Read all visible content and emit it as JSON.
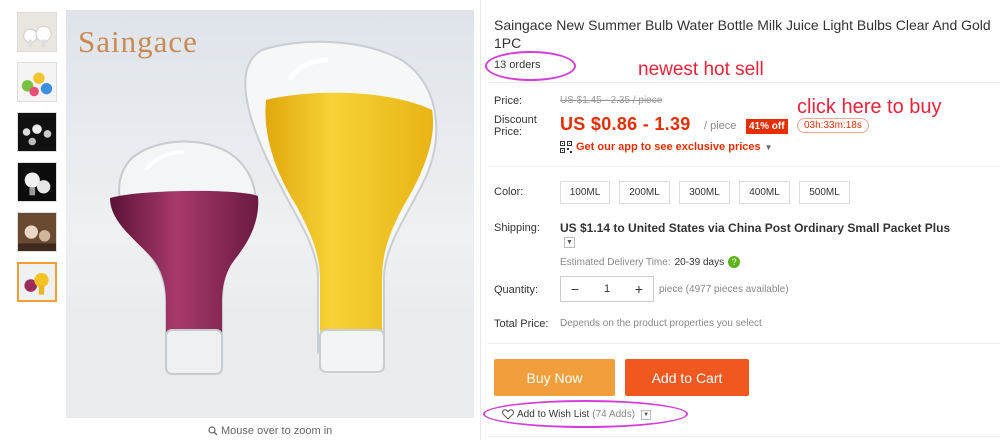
{
  "brand": "Saingace",
  "thumbnails": [
    "thumb-1",
    "thumb-2",
    "thumb-3",
    "thumb-4",
    "thumb-5",
    "thumb-6"
  ],
  "zoom_hint": "Mouse over to zoom in",
  "product": {
    "title": "Saingace New Summer Bulb Water Bottle Milk Juice Light Bulbs Clear And Gold 1PC",
    "orders": "13 orders"
  },
  "annotations": {
    "hot": "newest hot sell",
    "buy": "click here to buy"
  },
  "price": {
    "label": "Price:",
    "original": "US $1.45 - 2.35 / piece",
    "discount_label_1": "Discount",
    "discount_label_2": "Price:",
    "discount": "US $0.86 - 1.39",
    "unit": "/ piece",
    "off": "41% off",
    "timer": "03h:33m:18s",
    "app_promo": "Get our app to see exclusive prices"
  },
  "color": {
    "label": "Color:",
    "options": [
      "100ML",
      "200ML",
      "300ML",
      "400ML",
      "500ML"
    ]
  },
  "shipping": {
    "label": "Shipping:",
    "text": "US $1.14 to United States via China Post Ordinary Small Packet Plus",
    "delivery_label": "Estimated Delivery Time:",
    "delivery_days": "20-39 days"
  },
  "quantity": {
    "label": "Quantity:",
    "minus": "−",
    "value": "1",
    "plus": "+",
    "stock": "piece (4977 pieces available)"
  },
  "total": {
    "label": "Total Price:",
    "note": "Depends on the product properties you select"
  },
  "buttons": {
    "buy_now": "Buy Now",
    "add_to_cart": "Add to Cart"
  },
  "wishlist": {
    "label": "Add to Wish List",
    "count": "(74 Adds)"
  },
  "colors": {
    "price_red": "#e62e04",
    "buy_orange": "#f19f3c",
    "cart_orange": "#f0581f",
    "annotation_red": "#e5233b",
    "annotation_circle": "#d43ed8"
  }
}
